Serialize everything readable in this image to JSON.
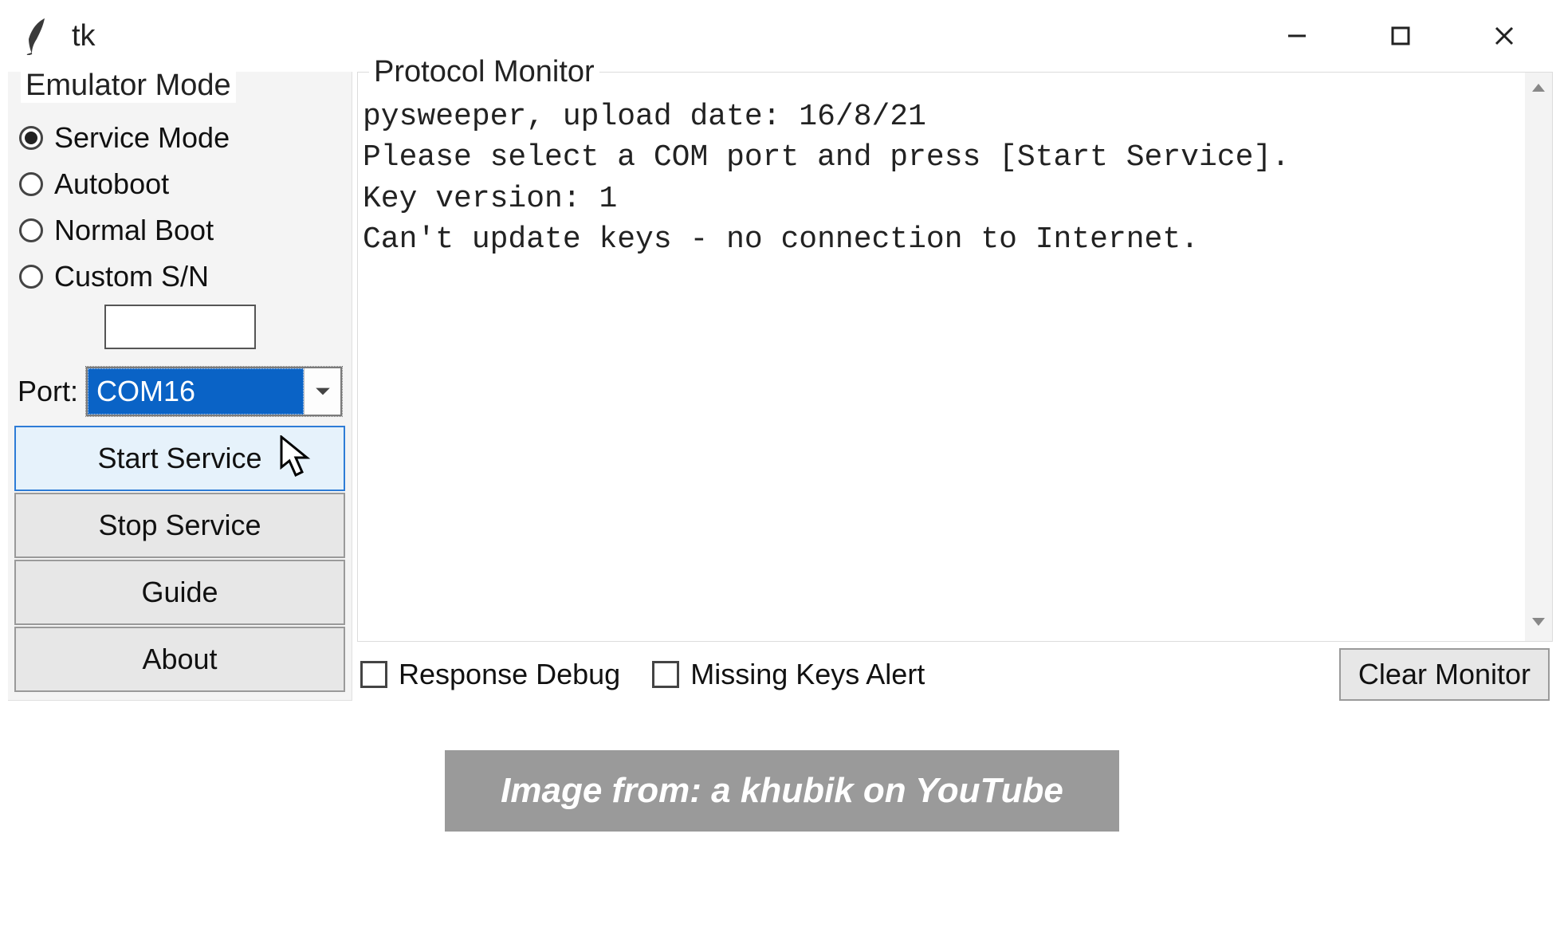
{
  "window": {
    "title": "tk"
  },
  "left": {
    "group_label": "Emulator Mode",
    "radios": {
      "service_mode": "Service Mode",
      "autoboot": "Autoboot",
      "normal_boot": "Normal Boot",
      "custom_sn": "Custom S/N",
      "selected": "service_mode"
    },
    "sn_value": "",
    "port_label": "Port:",
    "port_value": "COM16",
    "buttons": {
      "start": "Start Service",
      "stop": "Stop Service",
      "guide": "Guide",
      "about": "About"
    }
  },
  "monitor": {
    "label": "Protocol Monitor",
    "text": "pysweeper, upload date: 16/8/21\nPlease select a COM port and press [Start Service].\nKey version: 1\nCan't update keys - no connection to Internet."
  },
  "bottom": {
    "response_debug": "Response Debug",
    "missing_keys_alert": "Missing Keys Alert",
    "clear": "Clear Monitor"
  },
  "attribution": "Image from: a khubik on YouTube"
}
